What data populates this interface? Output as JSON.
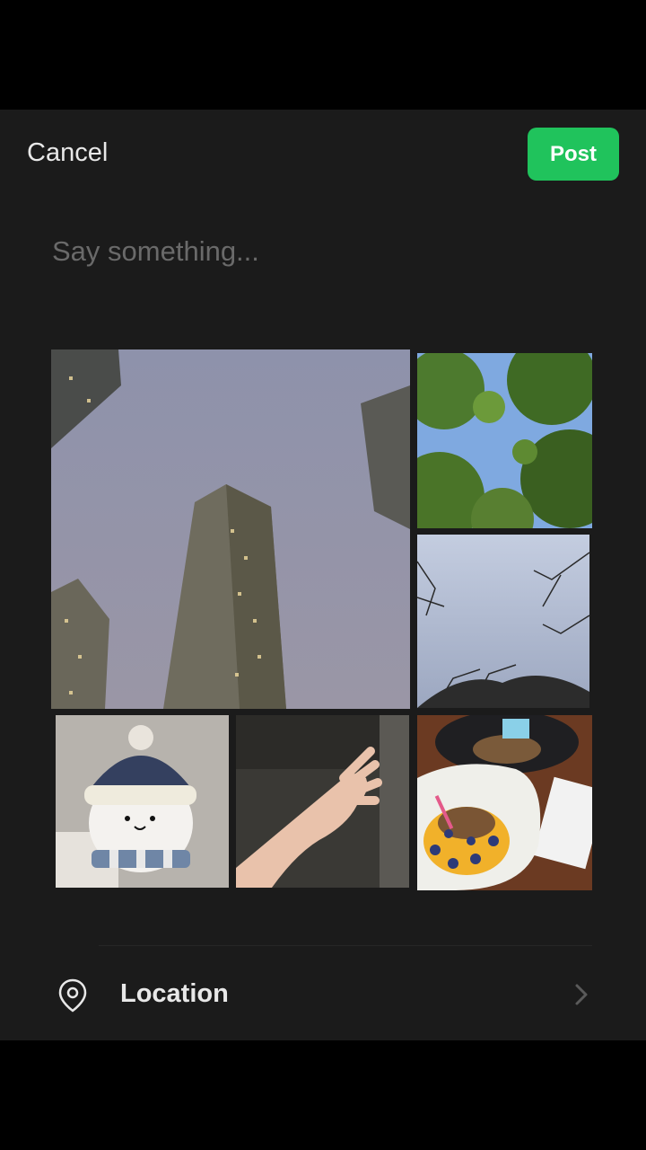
{
  "header": {
    "cancel_label": "Cancel",
    "post_label": "Post",
    "post_color": "#20c35c"
  },
  "composer": {
    "placeholder": "Say something..."
  },
  "photos": [
    {
      "subject": "tall apartment buildings at dusk"
    },
    {
      "subject": "tree canopy against blue sky"
    },
    {
      "subject": "bare branches against pale sky"
    },
    {
      "subject": "plush bear toy with knit hat and scarf"
    },
    {
      "subject": "hand"
    },
    {
      "subject": "dessert plates on table"
    }
  ],
  "location": {
    "label": "Location",
    "icon": "location-pin-icon",
    "chevron": "chevron-right-icon"
  }
}
